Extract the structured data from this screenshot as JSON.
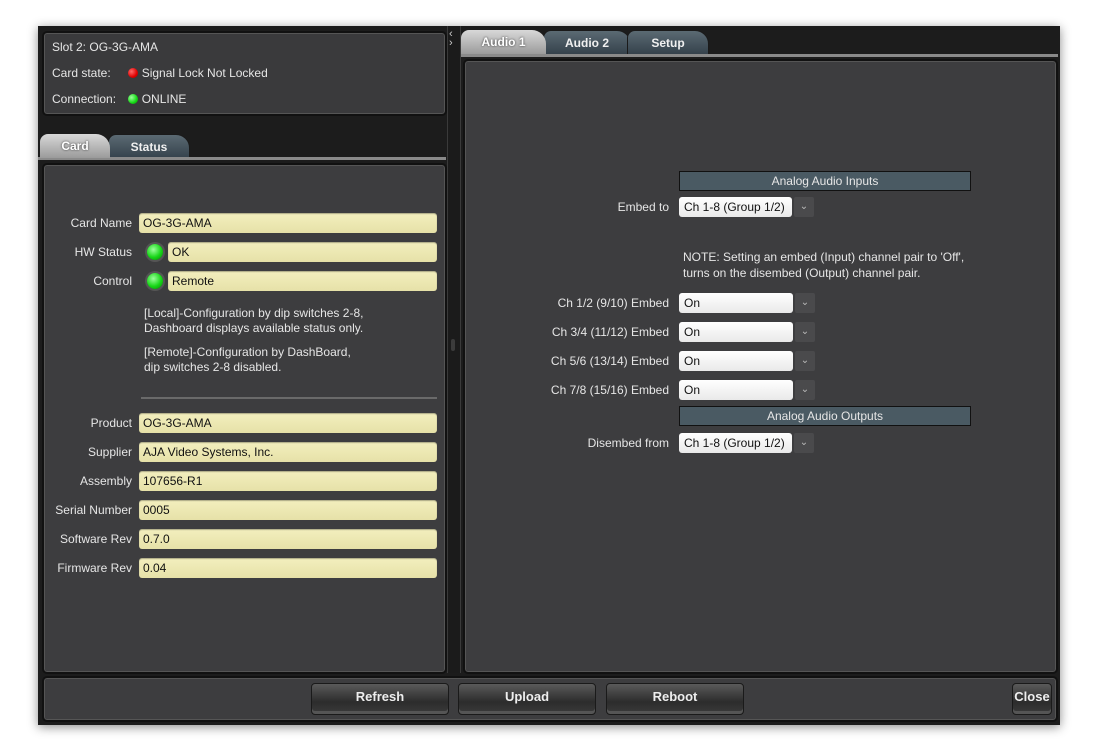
{
  "info": {
    "slot": "Slot 2: OG-3G-AMA",
    "card_state_label": "Card state:",
    "card_state_value": "Signal Lock Not Locked",
    "card_state_color": "#e00000",
    "connection_label": "Connection:",
    "connection_value": "ONLINE",
    "connection_color": "#12d812"
  },
  "left_tabs": [
    {
      "label": "Card",
      "active": true
    },
    {
      "label": "Status",
      "active": false
    }
  ],
  "card": {
    "card_name_label": "Card Name",
    "card_name": "OG-3G-AMA",
    "hw_status_label": "HW Status",
    "hw_status": "OK",
    "control_label": "Control",
    "control": "Remote",
    "help_local_1": "[Local]-Configuration by dip switches 2-8,",
    "help_local_2": "Dashboard displays available status only.",
    "help_remote_1": "[Remote]-Configuration by DashBoard,",
    "help_remote_2": "dip switches 2-8 disabled.",
    "fields": [
      {
        "label": "Product",
        "value": "OG-3G-AMA"
      },
      {
        "label": "Supplier",
        "value": "AJA Video Systems, Inc."
      },
      {
        "label": "Assembly",
        "value": "107656-R1"
      },
      {
        "label": "Serial Number",
        "value": "0005"
      },
      {
        "label": "Software Rev",
        "value": "0.7.0"
      },
      {
        "label": "Firmware Rev",
        "value": "0.04"
      }
    ]
  },
  "splitter": {
    "collapse_icon": "‹",
    "expand_icon": "›"
  },
  "right_tabs": [
    {
      "label": "Audio 1",
      "active": true
    },
    {
      "label": "Audio 2",
      "active": false
    },
    {
      "label": "Setup",
      "active": false
    }
  ],
  "audio": {
    "inputs_header": "Analog Audio Inputs",
    "embed_to_label": "Embed to",
    "embed_to_value": "Ch 1-8  (Group 1/2)",
    "note_1": "NOTE: Setting an embed (Input) channel pair to 'Off',",
    "note_2": "turns on the disembed (Output) channel pair.",
    "channels": [
      {
        "label": "Ch 1/2 (9/10) Embed",
        "value": "On"
      },
      {
        "label": "Ch 3/4 (11/12) Embed",
        "value": "On"
      },
      {
        "label": "Ch 5/6 (13/14) Embed",
        "value": "On"
      },
      {
        "label": "Ch 7/8 (15/16) Embed",
        "value": "On"
      }
    ],
    "outputs_header": "Analog Audio Outputs",
    "disembed_label": "Disembed from",
    "disembed_value": "Ch 1-8  (Group 1/2)",
    "dropdown_icon": "⌄"
  },
  "buttons": {
    "refresh": "Refresh",
    "upload": "Upload",
    "reboot": "Reboot",
    "close": "Close"
  }
}
